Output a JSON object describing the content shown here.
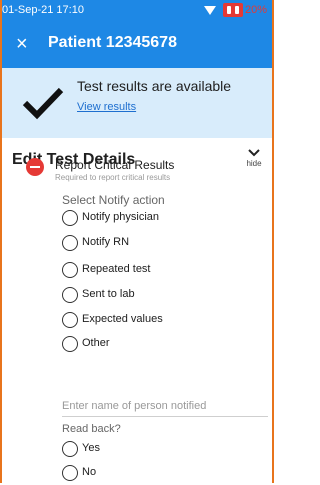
{
  "status": {
    "time": "01-Sep-21 17:10",
    "battery_text": "20%",
    "wifi_icon": "wifi-icon",
    "battery_icon": "battery-low-icon",
    "battery_color": "#e53935"
  },
  "appbar": {
    "close_glyph": "×",
    "title": "Patient 12345678",
    "color": "#1e88e5"
  },
  "banner": {
    "message": "Test results are available",
    "link": "View results",
    "background": "#d8ecfb"
  },
  "section": {
    "title": "Edit Test Details",
    "hide_label": "hide"
  },
  "critical": {
    "label": "Report Critical Results",
    "sub": "Required to report critical results",
    "badge_color": "#e53935"
  },
  "notify": {
    "title": "Select Notify action",
    "options": [
      "Notify physician",
      "Notify RN",
      "Repeated test",
      "Sent to lab",
      "Expected values",
      "Other"
    ]
  },
  "person_input": {
    "placeholder": "Enter name of person notified"
  },
  "readback": {
    "title": "Read back?",
    "options": [
      "Yes",
      "No"
    ]
  }
}
